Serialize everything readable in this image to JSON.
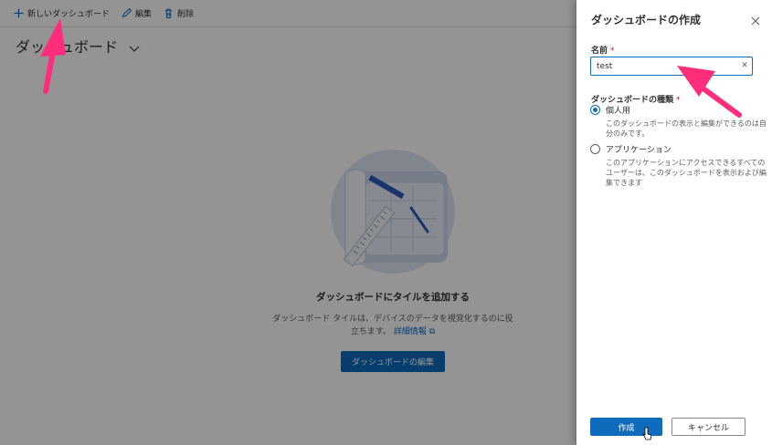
{
  "toolbar": {
    "new_label": "新しいダッシュボード",
    "edit_label": "編集",
    "delete_label": "削除"
  },
  "page": {
    "title": "ダッシュボード"
  },
  "empty_state": {
    "title": "ダッシュボードにタイルを追加する",
    "description": "ダッシュボード タイルは、デバイスのデータを視覚化するのに役立ちます。",
    "link_label": "詳細情報",
    "button_label": "ダッシュボードの編集"
  },
  "panel": {
    "title": "ダッシュボードの作成",
    "name_label": "名前",
    "name_value": "test",
    "type_label": "ダッシュボードの種類",
    "options": [
      {
        "label": "個人用",
        "description": "このダッシュボードの表示と編集ができるのは自分のみです。",
        "checked": true
      },
      {
        "label": "アプリケーション",
        "description": "このアプリケーションにアクセスできるすべてのユーザーは、このダッシュボードを表示および編集できます",
        "checked": false
      }
    ],
    "create_label": "作成",
    "cancel_label": "キャンセル",
    "required_mark": "*"
  },
  "icons": {
    "new": "plus-icon",
    "edit": "pencil-icon",
    "delete": "trash-icon",
    "chevron": "chevron-down-icon",
    "close": "close-icon",
    "clear": "clear-icon",
    "external": "external-link-icon"
  },
  "colors": {
    "accent": "#0f6cbd",
    "annotation_arrow": "#ff2d7a",
    "overlay": "#000000"
  }
}
